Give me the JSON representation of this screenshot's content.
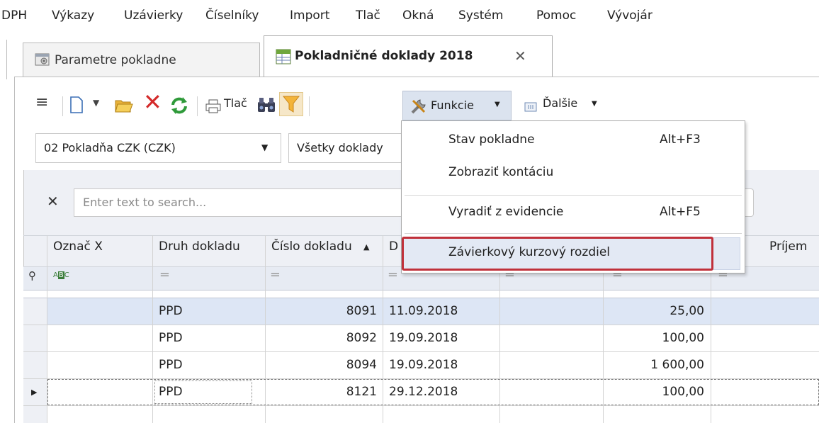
{
  "menu": [
    "DPH",
    "Výkazy",
    "Uzávierky",
    "Číselníky",
    "Import",
    "Tlač",
    "Okná",
    "Systém",
    "Pomoc",
    "Vývojár"
  ],
  "tabs": [
    {
      "label": "Parametre pokladne",
      "active": false
    },
    {
      "label": "Pokladničné doklady 2018",
      "active": true
    }
  ],
  "toolbar": {
    "print_label": "Tlač",
    "funkcie_label": "Funkcie",
    "dalsie_label": "Ďalšie"
  },
  "filters": {
    "cashbox": "02 Pokladňa CZK (CZK)",
    "doc_filter": "Všetky doklady"
  },
  "search": {
    "placeholder": "Enter text to search..."
  },
  "grid": {
    "columns": [
      "Označ X",
      "Druh dokladu",
      "Číslo dokladu",
      "D",
      "Príjem"
    ],
    "filter_row_icon": "ABC",
    "rows": [
      {
        "druh": "PPD",
        "cislo": "8091",
        "datum": "11.09.2018",
        "suma": "25,00"
      },
      {
        "druh": "PPD",
        "cislo": "8092",
        "datum": "19.09.2018",
        "suma": "100,00"
      },
      {
        "druh": "PPD",
        "cislo": "8094",
        "datum": "19.09.2018",
        "suma": "1 600,00"
      },
      {
        "druh": "PPD",
        "cislo": "8121",
        "datum": "29.12.2018",
        "suma": "100,00"
      }
    ]
  },
  "dropdown": {
    "items": [
      {
        "label": "Stav pokladne",
        "shortcut": "Alt+F3"
      },
      {
        "label": "Zobraziť kontáciu",
        "shortcut": ""
      },
      {
        "label": "Vyradiť z evidencie",
        "shortcut": "Alt+F5"
      },
      {
        "label": "Závierkový kurzový rozdiel",
        "shortcut": ""
      }
    ]
  },
  "colors": {
    "highlight_border": "#c0303a",
    "selected_row": "#dde6f5",
    "header_bg": "#eef0f5"
  }
}
